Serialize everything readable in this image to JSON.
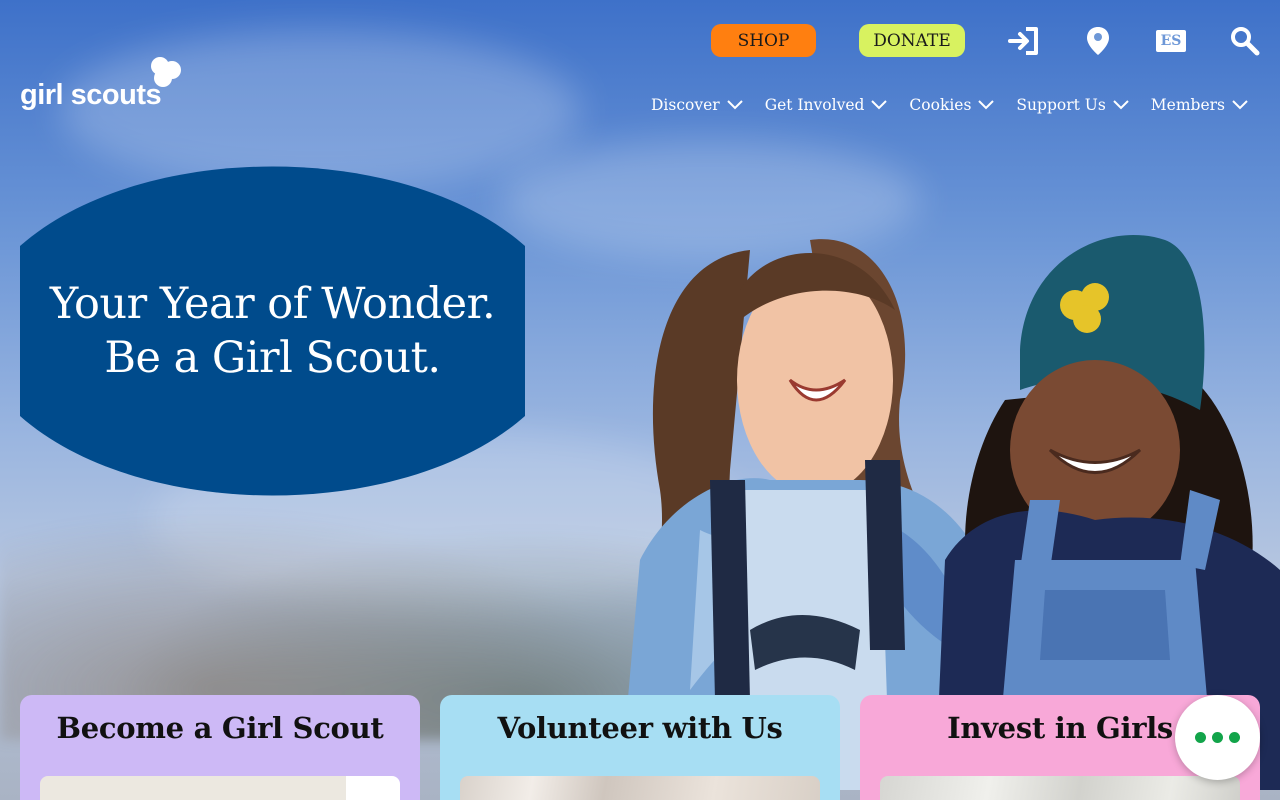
{
  "header": {
    "logo_text": "girl scouts",
    "shop_label": "SHOP",
    "donate_label": "DONATE",
    "language_label": "ES",
    "icons": [
      "sign-in-icon",
      "location-pin-icon",
      "language-icon",
      "search-icon"
    ]
  },
  "nav": {
    "items": [
      {
        "label": "Discover"
      },
      {
        "label": "Get Involved"
      },
      {
        "label": "Cookies"
      },
      {
        "label": "Support Us"
      },
      {
        "label": "Members"
      }
    ]
  },
  "hero": {
    "line1": "Your Year of Wonder.",
    "line2": "Be a Girl Scout."
  },
  "cards": [
    {
      "title": "Become a Girl Scout"
    },
    {
      "title": "Volunteer with Us"
    },
    {
      "title": "Invest in Girls"
    }
  ],
  "colors": {
    "shop": "#ff7f10",
    "donate": "#d8f260",
    "hero_badge": "#004b8c",
    "card_purple": "#cdb9f6",
    "card_blue": "#a7def3",
    "card_pink": "#f8a8d8",
    "chat_dots": "#12a44a"
  }
}
